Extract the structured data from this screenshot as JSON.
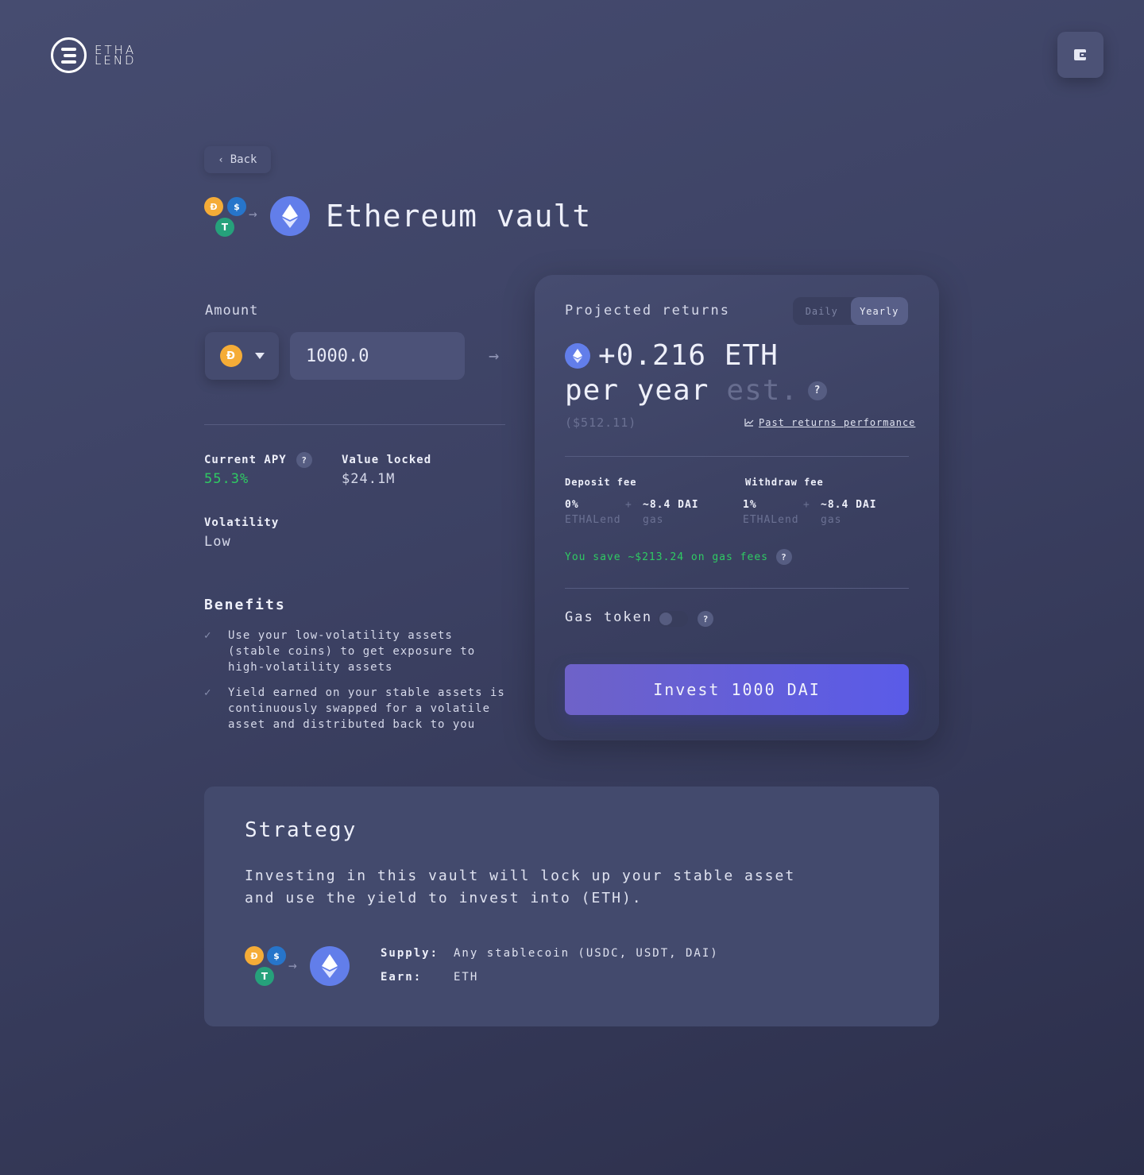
{
  "brand": {
    "logo_line1": "ETHA",
    "logo_line2": "LEND"
  },
  "header": {
    "wallet_icon": "wallet-icon"
  },
  "nav": {
    "back_label": "Back"
  },
  "vault": {
    "title": "Ethereum vault",
    "from_tokens": [
      "DAI",
      "USDC",
      "USDT"
    ],
    "to_token": "ETH"
  },
  "deposit": {
    "amount_label": "Amount",
    "selected_token": "DAI",
    "amount_value": "1000.0",
    "arrow_icon": "arrow-right-icon"
  },
  "stats": {
    "apy_label": "Current APY",
    "apy_value": "55.3%",
    "tvl_label": "Value locked",
    "tvl_value": "$24.1M",
    "volatility_label": "Volatility",
    "volatility_value": "Low"
  },
  "benefits": {
    "title": "Benefits",
    "items": [
      "Use your low-volatility assets (stable coins) to get exposure to high-volatility assets",
      "Yield earned on your stable assets is continuously swapped for a volatile asset and distributed back to you"
    ]
  },
  "returns": {
    "title": "Projected returns",
    "period_options": [
      "Daily",
      "Yearly"
    ],
    "selected_period": "Yearly",
    "amount": "+0.216 ETH",
    "per_label": "per year",
    "est_label": "est.",
    "usd_value": "($512.11)",
    "past_link": "Past returns performance",
    "deposit_fee": {
      "label": "Deposit fee",
      "pct": "0%",
      "pct_sub": "ETHALend",
      "plus": "+",
      "gas": "~8.4 DAI",
      "gas_sub": "gas"
    },
    "withdraw_fee": {
      "label": "Withdraw fee",
      "pct": "1%",
      "pct_sub": "ETHALend",
      "plus": "+",
      "gas": "~8.4 DAI",
      "gas_sub": "gas"
    },
    "savings": "You save ~$213.24 on gas fees",
    "gas_token_label": "Gas token",
    "gas_token_enabled": false,
    "invest_label": "Invest 1000 DAI"
  },
  "strategy": {
    "title": "Strategy",
    "description": "Investing in this vault will lock up your stable asset and use the yield to invest into (ETH).",
    "supply_label": "Supply:",
    "supply_value": "Any stablecoin (USDC, USDT, DAI)",
    "earn_label": "Earn:",
    "earn_value": "ETH"
  },
  "colors": {
    "accent": "#5a5be8",
    "positive": "#2fca63",
    "eth": "#627eea",
    "dai": "#f5ac37",
    "usdc": "#2775ca",
    "usdt": "#26a17b"
  }
}
